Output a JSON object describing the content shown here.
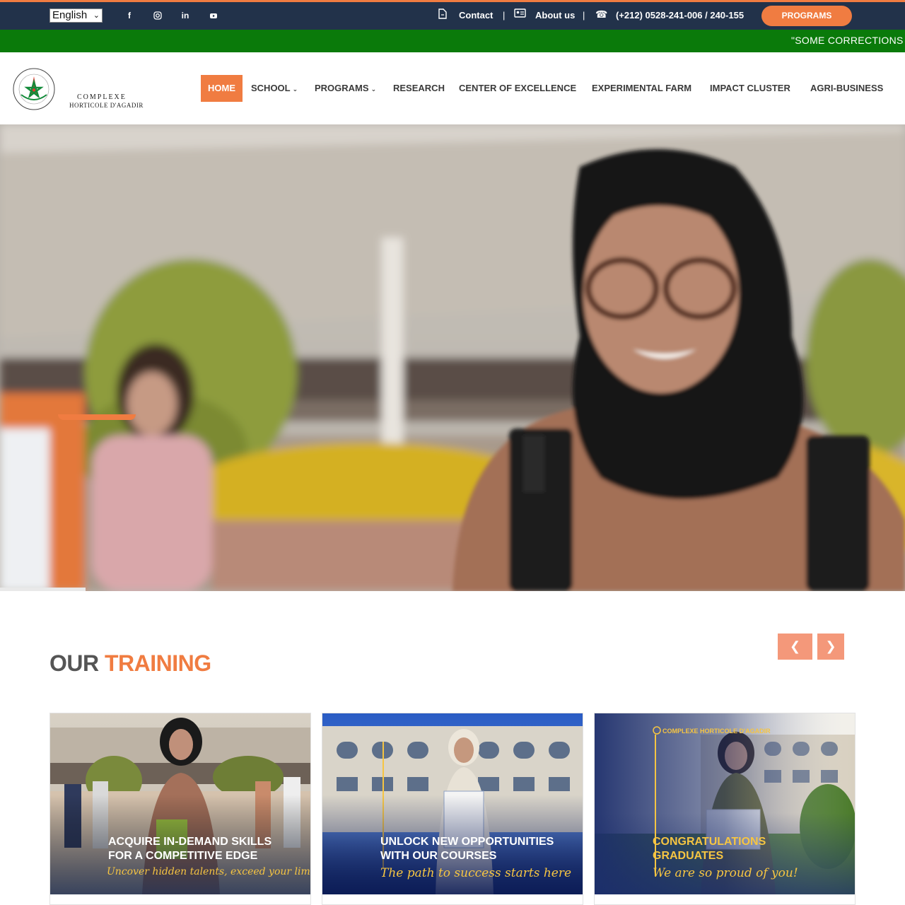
{
  "topbar": {
    "language": "English",
    "social_icons": [
      "facebook-icon",
      "instagram-icon",
      "linkedin-icon",
      "youtube-icon"
    ],
    "contact_label": "Contact",
    "about_label": "About us",
    "phone": "(+212) 0528-241-006 / 240-155",
    "separator": "|",
    "programs_button": "PROGRAMS"
  },
  "ticker": {
    "text": "\"SOME CORRECTIONS A"
  },
  "logo": {
    "line1": "COMPLEXE",
    "line2": "HORTICOLE D'AGADIR"
  },
  "nav": {
    "items": [
      {
        "label": "HOME",
        "active": true
      },
      {
        "label": "SCHOOL",
        "dropdown": true
      },
      {
        "label": "PROGRAMS",
        "dropdown": true
      },
      {
        "label": "RESEARCH"
      },
      {
        "label": "CENTER OF EXCELLENCE"
      },
      {
        "label": "EXPERIMENTAL FARM"
      },
      {
        "label": "IMPACT CLUSTER"
      },
      {
        "label": "AGRI-BUSINESS"
      }
    ]
  },
  "training": {
    "title_part1": "OUR",
    "title_part2": "TRAINING",
    "prev_icon": "chevron-left-icon",
    "next_icon": "chevron-right-icon",
    "cards": [
      {
        "line1": "ACQUIRE IN-DEMAND SKILLS",
        "line2": "FOR A COMPETITIVE EDGE",
        "tagline": "Uncover hidden talents, exceed your limits!",
        "brand": ""
      },
      {
        "line1": "UNLOCK NEW OPPORTUNITIES",
        "line2": "WITH OUR COURSES",
        "tagline": "The path to success starts here",
        "brand": ""
      },
      {
        "line1": "CONGRATULATIONS",
        "line2": "GRADUATES",
        "tagline": "We are so proud of you!",
        "brand": "COMPLEXE HORTICOLE D'AGADIR"
      }
    ]
  },
  "colors": {
    "accent": "#f07c41",
    "topbar": "#22324a",
    "ticker": "#0a7a0a",
    "arrow": "#f4987a"
  }
}
